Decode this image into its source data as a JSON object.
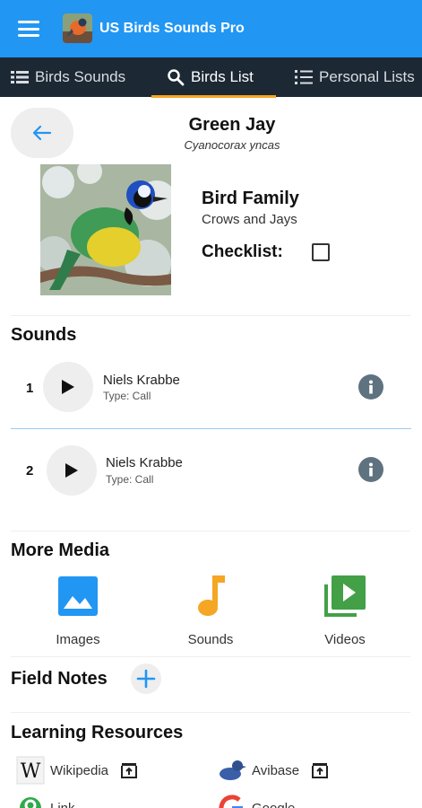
{
  "app": {
    "title": "US Birds Sounds Pro",
    "accent_color": "#2196f3",
    "tabbar_color": "#1c2833",
    "tab_indicator_color": "#f5a623"
  },
  "tabs": [
    {
      "label": "Birds Sounds",
      "icon": "list-icon"
    },
    {
      "label": "Birds List",
      "icon": "search-icon",
      "active": true
    },
    {
      "label": "Personal Lists",
      "icon": "checklist-icon"
    }
  ],
  "bird": {
    "common_name": "Green Jay",
    "scientific_name": "Cyanocorax yncas",
    "family_heading": "Bird Family",
    "family_name": "Crows and Jays",
    "checklist_label": "Checklist:",
    "checklist_checked": false
  },
  "sounds": {
    "title": "Sounds",
    "items": [
      {
        "number": "1",
        "author": "Niels Krabbe",
        "type": "Type: Call"
      },
      {
        "number": "2",
        "author": "Niels Krabbe",
        "type": "Type: Call"
      }
    ]
  },
  "more_media": {
    "title": "More Media",
    "items": [
      {
        "label": "Images",
        "icon": "image-icon",
        "color": "#2196f3"
      },
      {
        "label": "Sounds",
        "icon": "music-note-icon",
        "color": "#f5a623"
      },
      {
        "label": "Videos",
        "icon": "video-library-icon",
        "color": "#43a047"
      }
    ]
  },
  "field_notes": {
    "title": "Field Notes"
  },
  "learning_resources": {
    "title": "Learning Resources",
    "items": [
      {
        "label": "Wikipedia",
        "icon": "wikipedia-icon"
      },
      {
        "label": "Avibase",
        "icon": "avibase-icon"
      },
      {
        "label": "Link",
        "icon": "link-icon"
      },
      {
        "label": "Google",
        "icon": "google-icon"
      }
    ]
  }
}
